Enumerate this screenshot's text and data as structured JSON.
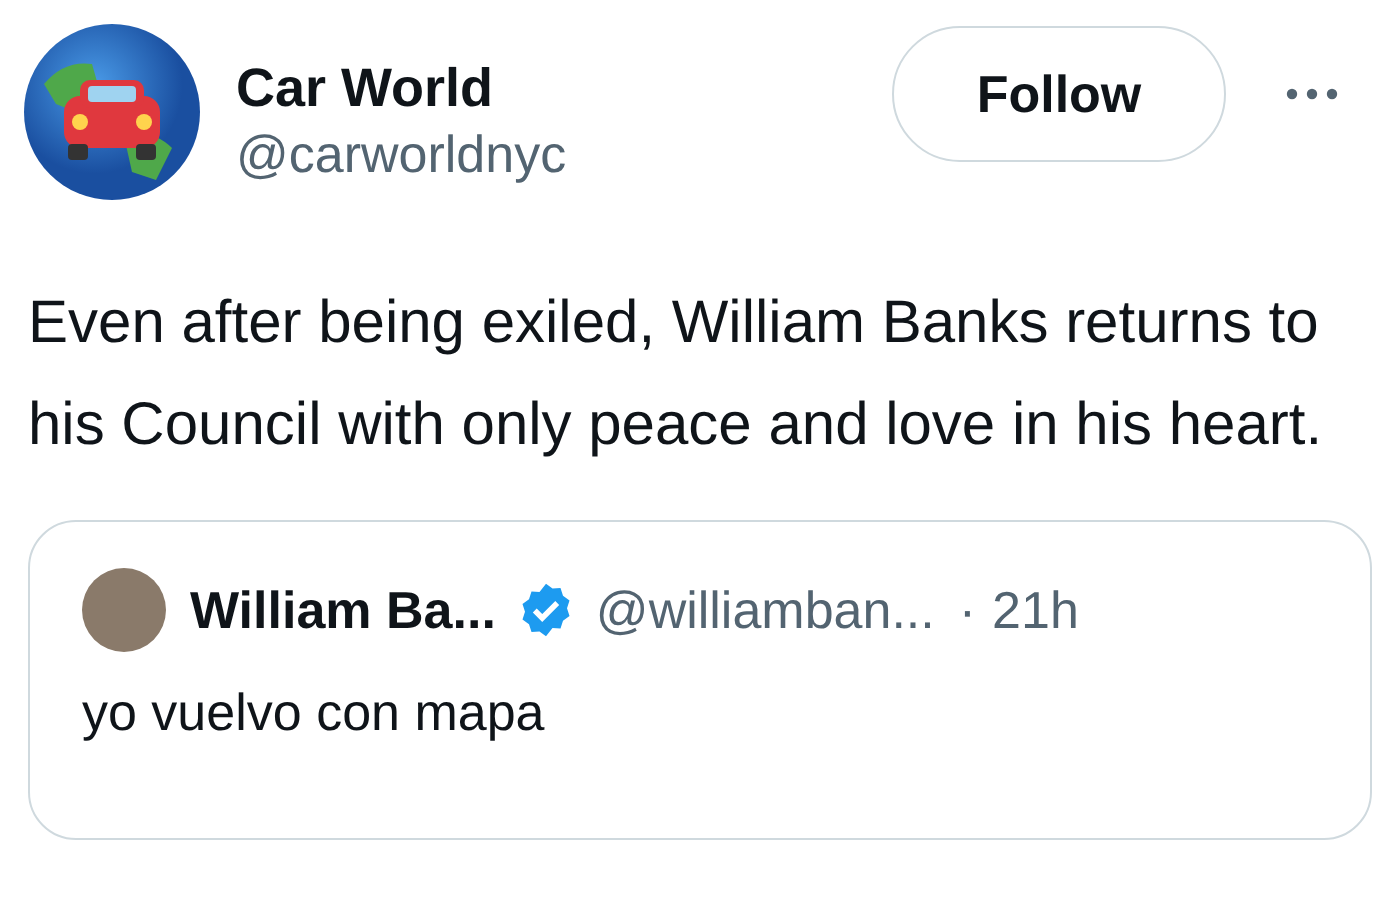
{
  "author": {
    "name": "Car World",
    "handle": "@carworldnyc"
  },
  "follow_button": {
    "label": "Follow"
  },
  "text": "Even after being exiled, William Banks returns to his Council with only peace and love in his heart.",
  "quoted_post": {
    "name": "William Ba...",
    "verified": true,
    "handle": "@williamban...",
    "separator": "·",
    "time": "21h",
    "text": "yo vuelvo con mapa"
  }
}
